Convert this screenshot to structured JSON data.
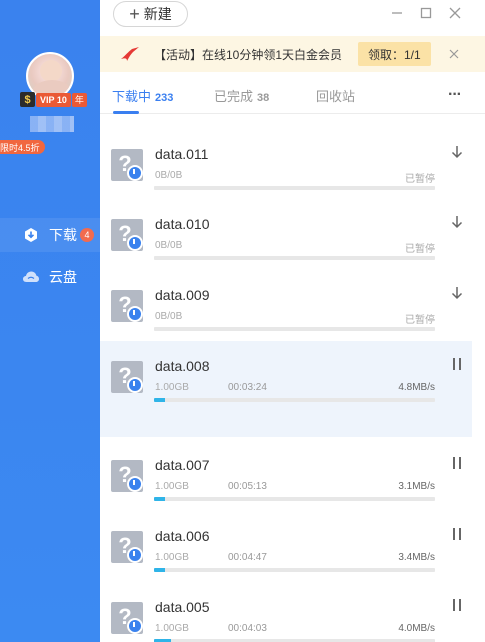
{
  "sidebar": {
    "vip_badge_s": "$",
    "vip_badge_text": "VIP 10",
    "vip_badge_year": "年",
    "promo_tag": "限时4.5折",
    "nav": [
      {
        "label": "下载",
        "count": "4",
        "icon": "download-icon"
      },
      {
        "label": "云盘",
        "icon": "cloud-icon"
      }
    ]
  },
  "topbar": {
    "new_button_label": "新建"
  },
  "banner": {
    "text": "【活动】在线10分钟领1天白金会员",
    "claim_label": "领取：1/1"
  },
  "tabs": [
    {
      "label": "下载中",
      "count": "233"
    },
    {
      "label": "已完成",
      "count": "38"
    },
    {
      "label": "回收站",
      "count": ""
    }
  ],
  "more_label": "···",
  "colors": {
    "accent": "#3a7ff0",
    "progress": "#2fb4e8",
    "sidebar": "#3b86f0"
  },
  "tasks": [
    {
      "name": "data.011",
      "size": "0B/0B",
      "elapsed": "",
      "status": "已暂停",
      "speed": "",
      "progress": 0,
      "action": "resume-download-icon"
    },
    {
      "name": "data.010",
      "size": "0B/0B",
      "elapsed": "",
      "status": "已暂停",
      "speed": "",
      "progress": 0,
      "action": "resume-download-icon"
    },
    {
      "name": "data.009",
      "size": "0B/0B",
      "elapsed": "",
      "status": "已暂停",
      "speed": "",
      "progress": 0,
      "action": "resume-download-icon"
    },
    {
      "name": "data.008",
      "size": "1.00GB",
      "elapsed": "00:03:24",
      "status": "",
      "speed": "4.8MB/s",
      "progress": 0.04,
      "action": "pause-icon"
    },
    {
      "name": "data.007",
      "size": "1.00GB",
      "elapsed": "00:05:13",
      "status": "",
      "speed": "3.1MB/s",
      "progress": 0.04,
      "action": "pause-icon"
    },
    {
      "name": "data.006",
      "size": "1.00GB",
      "elapsed": "00:04:47",
      "status": "",
      "speed": "3.4MB/s",
      "progress": 0.04,
      "action": "pause-icon"
    },
    {
      "name": "data.005",
      "size": "1.00GB",
      "elapsed": "00:04:03",
      "status": "",
      "speed": "4.0MB/s",
      "progress": 0.06,
      "action": "pause-icon"
    }
  ]
}
